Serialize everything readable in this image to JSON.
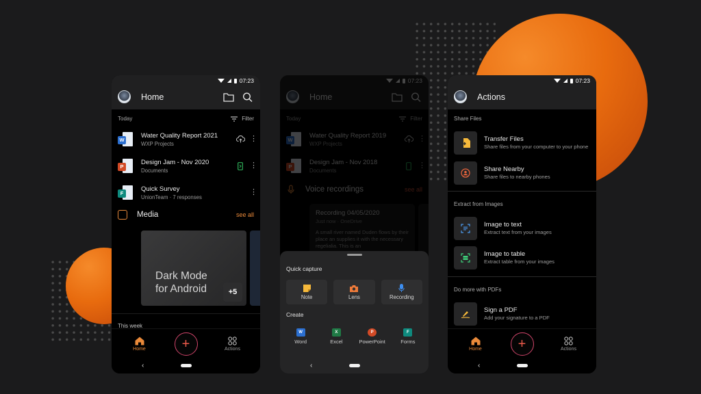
{
  "colors": {
    "accent_orange": "#ea8a3a",
    "fab_ring": "#d2456b",
    "background": "#1b1b1c",
    "appbar": "#202021",
    "word": "#2b6fd0",
    "powerpoint": "#d24a26",
    "forms": "#0e8a7e",
    "excel": "#1f7a45"
  },
  "status_bar": {
    "time": "07:23"
  },
  "phone_home": {
    "title": "Home",
    "section_today": "Today",
    "filter_label": "Filter",
    "files": [
      {
        "name": "Water Quality Report 2021",
        "sub": "WXP Projects",
        "app": "W",
        "action_icon": "cloud-upload-icon"
      },
      {
        "name": "Design Jam - Nov 2020",
        "sub": "Documents",
        "app": "P",
        "action_icon": "phone-sync-icon"
      },
      {
        "name": "Quick Survey",
        "sub": "UnionTeam · 7 responses",
        "app": "F",
        "action_icon": ""
      }
    ],
    "media_title": "Media",
    "see_all": "see all",
    "media_card": {
      "line1": "Dark Mode",
      "line2": "for Android",
      "more_count": "+5"
    },
    "section_this_week": "This week"
  },
  "phone_create": {
    "title": "Home",
    "section_today": "Today",
    "filter_label": "Filter",
    "files": [
      {
        "name": "Water Quality Report 2019",
        "sub": "WXP Projects",
        "app": "W"
      },
      {
        "name": "Design Jam - Nov 2018",
        "sub": "Documents",
        "app": "P"
      }
    ],
    "voice_title": "Voice recordings",
    "see_all": "see all",
    "recording": {
      "title": "Recording 04/05/2020",
      "sub": "Just now · OneDrive",
      "body": "A small river named Duden flows by their place an supplies it with the necessary regelialia. This is an"
    },
    "sheet": {
      "quick_capture_label": "Quick capture",
      "quick_capture": [
        {
          "label": "Note",
          "icon": "note-icon"
        },
        {
          "label": "Lens",
          "icon": "camera-icon"
        },
        {
          "label": "Recording",
          "icon": "microphone-icon"
        }
      ],
      "create_label": "Create",
      "create": [
        {
          "label": "Word",
          "letter": "W"
        },
        {
          "label": "Excel",
          "letter": "X"
        },
        {
          "label": "PowerPoint",
          "letter": "P"
        },
        {
          "label": "Forms",
          "letter": "F"
        }
      ]
    }
  },
  "phone_actions": {
    "title": "Actions",
    "sections": [
      {
        "label": "Share Files",
        "items": [
          {
            "title": "Transfer Files",
            "sub": "Share files from your computer to your phone",
            "icon": "transfer-files-icon"
          },
          {
            "title": "Share Nearby",
            "sub": "Share files to nearby phones",
            "icon": "share-nearby-icon"
          }
        ]
      },
      {
        "label": "Extract from Images",
        "items": [
          {
            "title": "Image to text",
            "sub": "Extract text from your images",
            "icon": "image-to-text-icon"
          },
          {
            "title": "Image to table",
            "sub": "Extract table from your images",
            "icon": "image-to-table-icon"
          }
        ]
      },
      {
        "label": "Do more with PDFs",
        "items": [
          {
            "title": "Sign a PDF",
            "sub": "Add your signature to a PDF",
            "icon": "sign-pdf-icon"
          }
        ]
      }
    ]
  },
  "bottom_nav": {
    "home_label": "Home",
    "actions_label": "Actions",
    "fab_symbol": "+"
  },
  "system_nav": {
    "back_symbol": "‹"
  }
}
